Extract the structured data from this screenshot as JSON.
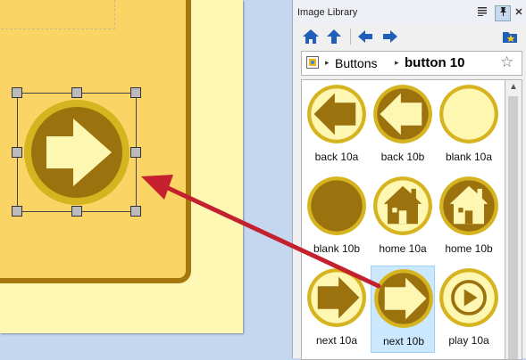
{
  "panel": {
    "title": "Image Library",
    "title_controls": [
      "menu-icon",
      "pin-icon",
      "close-icon"
    ],
    "close_glyph": "✕"
  },
  "toolbar": {
    "buttons": [
      "home-icon",
      "up-arrow-icon",
      "back-arrow-icon",
      "forward-arrow-icon",
      "favorite-folder-icon"
    ]
  },
  "breadcrumb": {
    "items": [
      "Buttons",
      "button 10"
    ],
    "separator": "▸",
    "favorite_icon": "☆"
  },
  "library": {
    "items": [
      {
        "label": "back 10a",
        "icon": "back-arrow",
        "style": "a"
      },
      {
        "label": "back 10b",
        "icon": "back-arrow",
        "style": "b"
      },
      {
        "label": "blank 10a",
        "icon": "blank",
        "style": "a"
      },
      {
        "label": "blank 10b",
        "icon": "blank",
        "style": "b"
      },
      {
        "label": "home 10a",
        "icon": "house",
        "style": "a"
      },
      {
        "label": "home 10b",
        "icon": "house",
        "style": "b"
      },
      {
        "label": "next 10a",
        "icon": "next-arrow",
        "style": "a"
      },
      {
        "label": "next 10b",
        "icon": "next-arrow",
        "style": "b",
        "selected": true
      },
      {
        "label": "play 10a",
        "icon": "play",
        "style": "a"
      }
    ]
  },
  "colors": {
    "gold_ring": "#d6b420",
    "brown": "#9c720e",
    "cream": "#fef7b2",
    "selection": "#cce8ff",
    "arrow_red": "#c4202e",
    "toolbar_blue": "#1f5fb8"
  }
}
